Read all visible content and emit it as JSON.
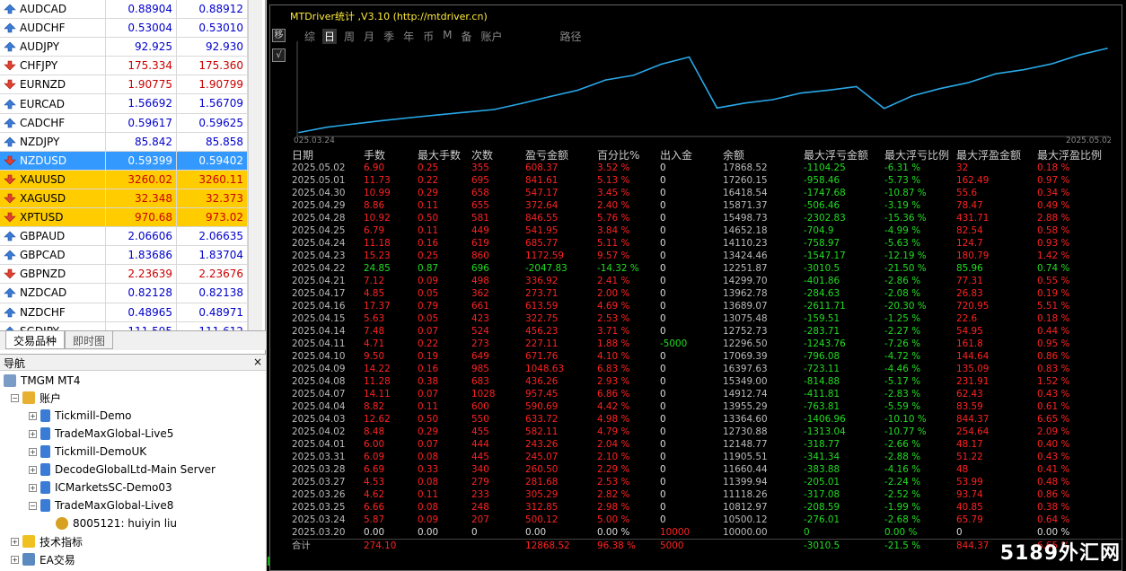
{
  "market_watch": {
    "rows": [
      {
        "symbol": "AUDCAD",
        "bid": "0.88904",
        "ask": "0.88912",
        "dir": "up",
        "style": ""
      },
      {
        "symbol": "AUDCHF",
        "bid": "0.53004",
        "ask": "0.53010",
        "dir": "up",
        "style": ""
      },
      {
        "symbol": "AUDJPY",
        "bid": "92.925",
        "ask": "92.930",
        "dir": "up",
        "style": ""
      },
      {
        "symbol": "CHFJPY",
        "bid": "175.334",
        "ask": "175.360",
        "dir": "down",
        "style": ""
      },
      {
        "symbol": "EURNZD",
        "bid": "1.90775",
        "ask": "1.90799",
        "dir": "down",
        "style": ""
      },
      {
        "symbol": "EURCAD",
        "bid": "1.56692",
        "ask": "1.56709",
        "dir": "up",
        "style": ""
      },
      {
        "symbol": "CADCHF",
        "bid": "0.59617",
        "ask": "0.59625",
        "dir": "up",
        "style": ""
      },
      {
        "symbol": "NZDJPY",
        "bid": "85.842",
        "ask": "85.858",
        "dir": "up",
        "style": ""
      },
      {
        "symbol": "NZDUSD",
        "bid": "0.59399",
        "ask": "0.59402",
        "dir": "down",
        "style": "sel"
      },
      {
        "symbol": "XAUUSD",
        "bid": "3260.02",
        "ask": "3260.11",
        "dir": "down",
        "style": "gold"
      },
      {
        "symbol": "XAGUSD",
        "bid": "32.348",
        "ask": "32.373",
        "dir": "down",
        "style": "gold"
      },
      {
        "symbol": "XPTUSD",
        "bid": "970.68",
        "ask": "973.02",
        "dir": "down",
        "style": "gold"
      },
      {
        "symbol": "GBPAUD",
        "bid": "2.06606",
        "ask": "2.06635",
        "dir": "up",
        "style": ""
      },
      {
        "symbol": "GBPCAD",
        "bid": "1.83686",
        "ask": "1.83704",
        "dir": "up",
        "style": ""
      },
      {
        "symbol": "GBPNZD",
        "bid": "2.23639",
        "ask": "2.23676",
        "dir": "down",
        "style": ""
      },
      {
        "symbol": "NZDCAD",
        "bid": "0.82128",
        "ask": "0.82138",
        "dir": "up",
        "style": ""
      },
      {
        "symbol": "NZDCHF",
        "bid": "0.48965",
        "ask": "0.48971",
        "dir": "up",
        "style": ""
      },
      {
        "symbol": "SGDJPY",
        "bid": "111.595",
        "ask": "111.612",
        "dir": "up",
        "style": ""
      }
    ],
    "tabs": [
      "交易品种",
      "即时图"
    ]
  },
  "navigator": {
    "title": "导航",
    "close": "×",
    "root": "TMGM MT4",
    "accounts_label": "账户",
    "accounts": [
      "Tickmill-Demo",
      "TradeMaxGlobal-Live5",
      "Tickmill-DemoUK",
      "DecodeGlobalLtd-Main Server",
      "ICMarketsSC-Demo03",
      "TradeMaxGlobal-Live8"
    ],
    "sub_account": "8005121: huiyin liu",
    "indicators": "技术指标",
    "ea": "EA交易"
  },
  "stats": {
    "title": "MTDriver统计 ,V3.10 (http://mtdriver.cn)",
    "menu": [
      "综",
      "日",
      "周",
      "月",
      "季",
      "年",
      "币",
      "M",
      "备",
      "账户",
      "路径"
    ],
    "menu_active": "日",
    "side_btns": [
      "移",
      "√"
    ],
    "chart_data": {
      "type": "line",
      "x": [
        "2025.03.20",
        "2025.03.24",
        "2025.03.25",
        "2025.03.26",
        "2025.03.27",
        "2025.03.28",
        "2025.03.31",
        "2025.04.01",
        "2025.04.02",
        "2025.04.03",
        "2025.04.04",
        "2025.04.07",
        "2025.04.08",
        "2025.04.09",
        "2025.04.10",
        "2025.04.11",
        "2025.04.14",
        "2025.04.15",
        "2025.04.16",
        "2025.04.17",
        "2025.04.21",
        "2025.04.22",
        "2025.04.23",
        "2025.04.24",
        "2025.04.25",
        "2025.04.28",
        "2025.04.29",
        "2025.04.30",
        "2025.05.01",
        "2025.05.02"
      ],
      "values": [
        10000.0,
        10500.12,
        10812.97,
        11118.26,
        11399.94,
        11660.44,
        11905.51,
        12148.77,
        12730.88,
        13364.6,
        13955.29,
        14912.74,
        15349.0,
        16397.63,
        17069.39,
        12296.5,
        12752.73,
        13075.48,
        13689.07,
        13962.78,
        14299.7,
        12251.87,
        13424.46,
        14110.23,
        14652.18,
        15498.73,
        15871.37,
        16418.54,
        17260.15,
        17868.52
      ],
      "x_start_label": "025.03.24",
      "x_end_label": "2025.05.02",
      "color": "#29a8e8"
    },
    "headers": [
      "日期",
      "手数",
      "最大手数",
      "次数",
      "盈亏金额",
      "百分比%",
      "出入金",
      "余额",
      "最大浮亏金额",
      "最大浮亏比例",
      "最大浮盈金额",
      "最大浮盈比例"
    ],
    "rows": [
      [
        "2025.05.02",
        "6.90",
        "0.25",
        "355",
        "608.37",
        "3.52 %",
        "0",
        "17868.52",
        "-1104.25",
        "-6.31 %",
        "32",
        "0.18 %"
      ],
      [
        "2025.05.01",
        "11.73",
        "0.22",
        "695",
        "841.61",
        "5.13 %",
        "0",
        "17260.15",
        "-958.46",
        "-5.73 %",
        "162.49",
        "0.97 %"
      ],
      [
        "2025.04.30",
        "10.99",
        "0.29",
        "658",
        "547.17",
        "3.45 %",
        "0",
        "16418.54",
        "-1747.68",
        "-10.87 %",
        "55.6",
        "0.34 %"
      ],
      [
        "2025.04.29",
        "8.86",
        "0.11",
        "655",
        "372.64",
        "2.40 %",
        "0",
        "15871.37",
        "-506.46",
        "-3.19 %",
        "78.47",
        "0.49 %"
      ],
      [
        "2025.04.28",
        "10.92",
        "0.50",
        "581",
        "846.55",
        "5.76 %",
        "0",
        "15498.73",
        "-2302.83",
        "-15.36 %",
        "431.71",
        "2.88 %"
      ],
      [
        "2025.04.25",
        "6.79",
        "0.11",
        "449",
        "541.95",
        "3.84 %",
        "0",
        "14652.18",
        "-704.9",
        "-4.99 %",
        "82.54",
        "0.58 %"
      ],
      [
        "2025.04.24",
        "11.18",
        "0.16",
        "619",
        "685.77",
        "5.11 %",
        "0",
        "14110.23",
        "-758.97",
        "-5.63 %",
        "124.7",
        "0.93 %"
      ],
      [
        "2025.04.23",
        "15.23",
        "0.25",
        "860",
        "1172.59",
        "9.57 %",
        "0",
        "13424.46",
        "-1547.17",
        "-12.19 %",
        "180.79",
        "1.42 %"
      ],
      [
        "2025.04.22",
        "24.85",
        "0.87",
        "696",
        "-2047.83",
        "-14.32 %",
        "0",
        "12251.87",
        "-3010.5",
        "-21.50 %",
        "85.96",
        "0.74 %"
      ],
      [
        "2025.04.21",
        "7.12",
        "0.09",
        "498",
        "336.92",
        "2.41 %",
        "0",
        "14299.70",
        "-401.86",
        "-2.86 %",
        "77.31",
        "0.55 %"
      ],
      [
        "2025.04.17",
        "4.85",
        "0.05",
        "362",
        "273.71",
        "2.00 %",
        "0",
        "13962.78",
        "-284.63",
        "-2.08 %",
        "26.83",
        "0.19 %"
      ],
      [
        "2025.04.16",
        "17.37",
        "0.79",
        "661",
        "613.59",
        "4.69 %",
        "0",
        "13689.07",
        "-2611.71",
        "-20.30 %",
        "720.95",
        "5.51 %"
      ],
      [
        "2025.04.15",
        "5.63",
        "0.05",
        "423",
        "322.75",
        "2.53 %",
        "0",
        "13075.48",
        "-159.51",
        "-1.25 %",
        "22.6",
        "0.18 %"
      ],
      [
        "2025.04.14",
        "7.48",
        "0.07",
        "524",
        "456.23",
        "3.71 %",
        "0",
        "12752.73",
        "-283.71",
        "-2.27 %",
        "54.95",
        "0.44 %"
      ],
      [
        "2025.04.11",
        "4.71",
        "0.22",
        "273",
        "227.11",
        "1.88 %",
        "-5000",
        "12296.50",
        "-1243.76",
        "-7.26 %",
        "161.8",
        "0.95 %"
      ],
      [
        "2025.04.10",
        "9.50",
        "0.19",
        "649",
        "671.76",
        "4.10 %",
        "0",
        "17069.39",
        "-796.08",
        "-4.72 %",
        "144.64",
        "0.86 %"
      ],
      [
        "2025.04.09",
        "14.22",
        "0.16",
        "985",
        "1048.63",
        "6.83 %",
        "0",
        "16397.63",
        "-723.11",
        "-4.46 %",
        "135.09",
        "0.83 %"
      ],
      [
        "2025.04.08",
        "11.28",
        "0.38",
        "683",
        "436.26",
        "2.93 %",
        "0",
        "15349.00",
        "-814.88",
        "-5.17 %",
        "231.91",
        "1.52 %"
      ],
      [
        "2025.04.07",
        "14.11",
        "0.07",
        "1028",
        "957.45",
        "6.86 %",
        "0",
        "14912.74",
        "-411.81",
        "-2.83 %",
        "62.43",
        "0.43 %"
      ],
      [
        "2025.04.04",
        "8.82",
        "0.11",
        "600",
        "590.69",
        "4.42 %",
        "0",
        "13955.29",
        "-763.81",
        "-5.59 %",
        "83.59",
        "0.61 %"
      ],
      [
        "2025.04.03",
        "12.62",
        "0.50",
        "550",
        "633.72",
        "4.98 %",
        "0",
        "13364.60",
        "-1406.96",
        "-10.10 %",
        "844.37",
        "6.65 %"
      ],
      [
        "2025.04.02",
        "8.48",
        "0.29",
        "455",
        "582.11",
        "4.79 %",
        "0",
        "12730.88",
        "-1313.04",
        "-10.77 %",
        "254.64",
        "2.09 %"
      ],
      [
        "2025.04.01",
        "6.00",
        "0.07",
        "444",
        "243.26",
        "2.04 %",
        "0",
        "12148.77",
        "-318.77",
        "-2.66 %",
        "48.17",
        "0.40 %"
      ],
      [
        "2025.03.31",
        "6.09",
        "0.08",
        "445",
        "245.07",
        "2.10 %",
        "0",
        "11905.51",
        "-341.34",
        "-2.88 %",
        "51.22",
        "0.43 %"
      ],
      [
        "2025.03.28",
        "6.69",
        "0.33",
        "340",
        "260.50",
        "2.29 %",
        "0",
        "11660.44",
        "-383.88",
        "-4.16 %",
        "48",
        "0.41 %"
      ],
      [
        "2025.03.27",
        "4.53",
        "0.08",
        "279",
        "281.68",
        "2.53 %",
        "0",
        "11399.94",
        "-205.01",
        "-2.24 %",
        "53.99",
        "0.48 %"
      ],
      [
        "2025.03.26",
        "4.62",
        "0.11",
        "233",
        "305.29",
        "2.82 %",
        "0",
        "11118.26",
        "-317.08",
        "-2.52 %",
        "93.74",
        "0.86 %"
      ],
      [
        "2025.03.25",
        "6.66",
        "0.08",
        "248",
        "312.85",
        "2.98 %",
        "0",
        "10812.97",
        "-208.59",
        "-1.99 %",
        "40.85",
        "0.38 %"
      ],
      [
        "2025.03.24",
        "5.87",
        "0.09",
        "207",
        "500.12",
        "5.00 %",
        "0",
        "10500.12",
        "-276.01",
        "-2.68 %",
        "65.79",
        "0.64 %"
      ],
      [
        "2025.03.20",
        "0.00",
        "0.00",
        "0",
        "0.00",
        "0.00 %",
        "10000",
        "10000.00",
        "0",
        "0.00 %",
        "0",
        "0.00 %"
      ]
    ],
    "total": [
      "合计",
      "274.10",
      "",
      "",
      "12868.52",
      "96.38 %",
      "5000",
      "",
      "-3010.5",
      "-21.5 %",
      "844.37",
      "6.65 %"
    ]
  },
  "watermark": "5189外汇网"
}
